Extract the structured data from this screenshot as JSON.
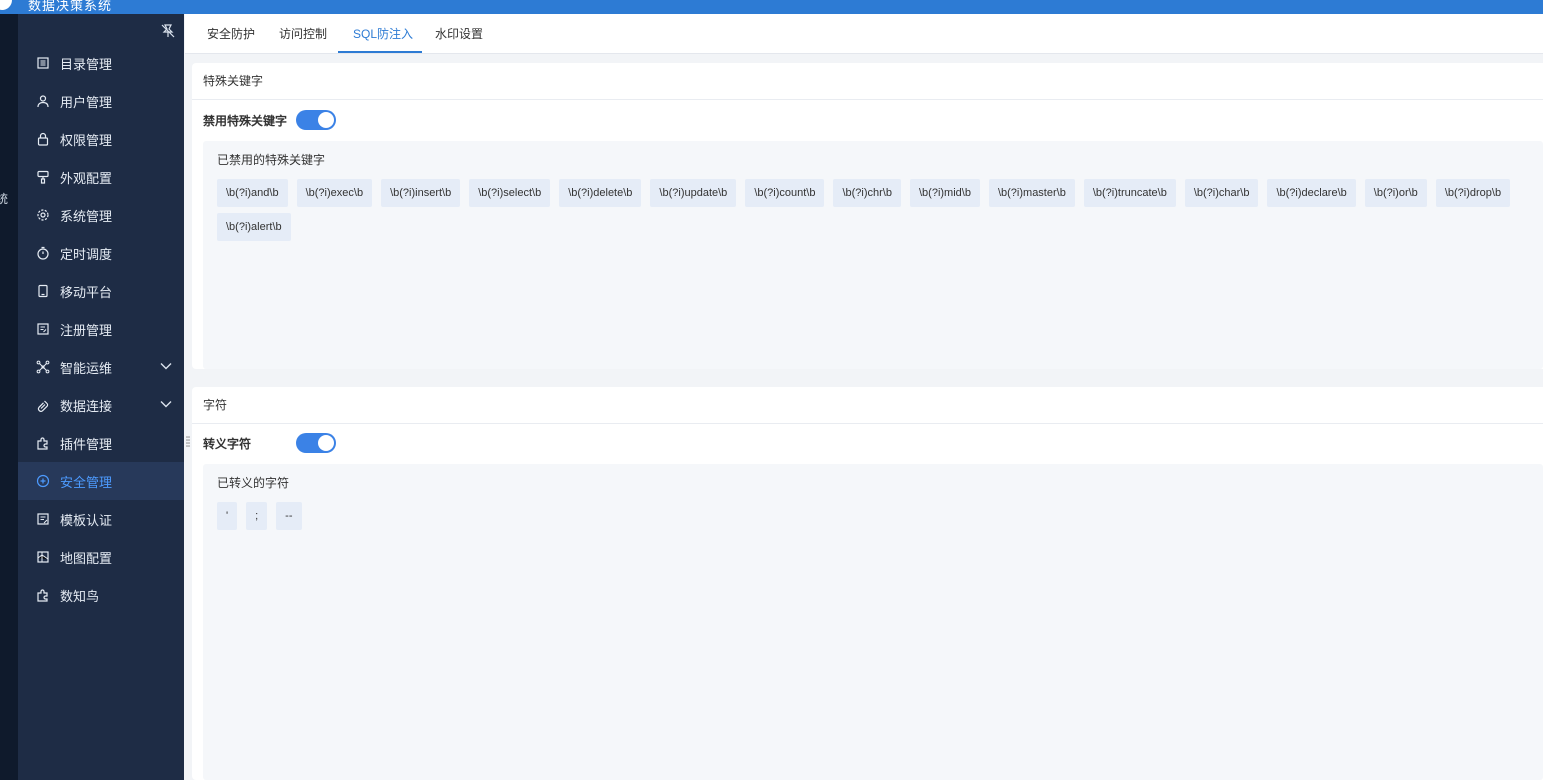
{
  "app": {
    "title": "数据决策系统"
  },
  "rail": {
    "text": "统"
  },
  "sidebar": {
    "pin_icon": "pin-icon",
    "items": [
      {
        "label": "目录管理",
        "icon": "catalog-icon",
        "expandable": false
      },
      {
        "label": "用户管理",
        "icon": "user-icon",
        "expandable": false
      },
      {
        "label": "权限管理",
        "icon": "lock-icon",
        "expandable": false
      },
      {
        "label": "外观配置",
        "icon": "brush-icon",
        "expandable": false
      },
      {
        "label": "系统管理",
        "icon": "gear-icon",
        "expandable": false
      },
      {
        "label": "定时调度",
        "icon": "timer-icon",
        "expandable": false
      },
      {
        "label": "移动平台",
        "icon": "tablet-icon",
        "expandable": false
      },
      {
        "label": "注册管理",
        "icon": "register-icon",
        "expandable": false
      },
      {
        "label": "智能运维",
        "icon": "network-icon",
        "expandable": true
      },
      {
        "label": "数据连接",
        "icon": "link-icon",
        "expandable": true
      },
      {
        "label": "插件管理",
        "icon": "plugin-icon",
        "expandable": false
      },
      {
        "label": "安全管理",
        "icon": "shield-icon",
        "expandable": false,
        "active": true
      },
      {
        "label": "模板认证",
        "icon": "template-icon",
        "expandable": false
      },
      {
        "label": "地图配置",
        "icon": "map-icon",
        "expandable": false
      },
      {
        "label": "数知鸟",
        "icon": "puzzle-icon",
        "expandable": false
      }
    ]
  },
  "tabs": {
    "items": [
      "安全防护",
      "访问控制",
      "SQL防注入",
      "水印设置"
    ],
    "active": "SQL防注入"
  },
  "keywords_section": {
    "header": "特殊关键字",
    "switch_label": "禁用特殊关键字",
    "switch_on": true,
    "box_title": "已禁用的特殊关键字",
    "items": [
      "\\b(?i)and\\b",
      "\\b(?i)exec\\b",
      "\\b(?i)insert\\b",
      "\\b(?i)select\\b",
      "\\b(?i)delete\\b",
      "\\b(?i)update\\b",
      "\\b(?i)count\\b",
      "\\b(?i)chr\\b",
      "\\b(?i)mid\\b",
      "\\b(?i)master\\b",
      "\\b(?i)truncate\\b",
      "\\b(?i)char\\b",
      "\\b(?i)declare\\b",
      "\\b(?i)or\\b",
      "\\b(?i)drop\\b",
      "\\b(?i)alert\\b"
    ]
  },
  "chars_section": {
    "header": "字符",
    "switch_label": "转义字符",
    "switch_on": true,
    "box_title": "已转义的字符",
    "items": [
      "'",
      ";",
      "--"
    ]
  },
  "colors": {
    "accent": "#2d7bd4",
    "sidebar_bg": "#1e2c45",
    "toggle_on": "#3b82e6"
  }
}
